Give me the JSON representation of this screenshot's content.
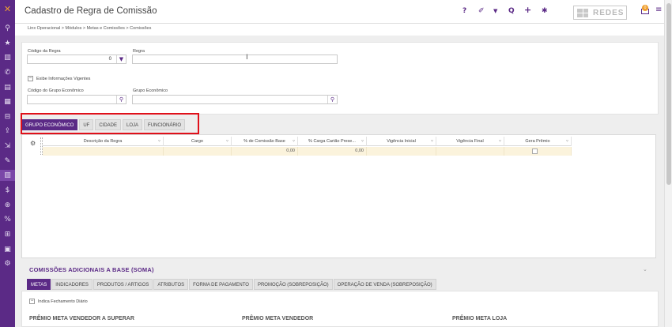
{
  "header": {
    "title": "Cadastro de Regra de Comissão",
    "brand": "REDES",
    "notification_count": "0",
    "icons": [
      "help-icon",
      "eraser-icon",
      "filter-icon",
      "search-icon",
      "add-icon",
      "settings-icon"
    ],
    "help_glyph": "?",
    "eraser_glyph": "✐",
    "filter_glyph": "▼",
    "search_glyph": "Q",
    "add_glyph": "+",
    "settings_glyph": "✱",
    "menu_glyph": "≡"
  },
  "breadcrumb": "Linx Operacional > Módulos > Metas e Comissões > Comissões",
  "sidebar": {
    "items": [
      {
        "icon": "linx-logo-icon",
        "glyph": "✕"
      },
      {
        "icon": "search-icon",
        "glyph": "⚲"
      },
      {
        "icon": "star-icon",
        "glyph": "★"
      },
      {
        "icon": "chart-icon",
        "glyph": "▥"
      },
      {
        "icon": "phone-icon",
        "glyph": "✆"
      },
      {
        "icon": "card-icon",
        "glyph": "▤"
      },
      {
        "icon": "calc-icon",
        "glyph": "▦"
      },
      {
        "icon": "basket-icon",
        "glyph": "⊟"
      },
      {
        "icon": "upload-icon",
        "glyph": "⇪"
      },
      {
        "icon": "truck-icon",
        "glyph": "⇲"
      },
      {
        "icon": "tag-icon",
        "glyph": "✎"
      },
      {
        "icon": "report-icon",
        "glyph": "▥"
      },
      {
        "icon": "dollar-icon",
        "glyph": "$"
      },
      {
        "icon": "coins-icon",
        "glyph": "⊛"
      },
      {
        "icon": "percent-icon",
        "glyph": "%"
      },
      {
        "icon": "cart-icon",
        "glyph": "⊞"
      },
      {
        "icon": "monitor-icon",
        "glyph": "▣"
      },
      {
        "icon": "gears-icon",
        "glyph": "⚙"
      }
    ]
  },
  "filters": {
    "codigo_regra_label": "Código da Regra",
    "codigo_regra_value": "0",
    "regra_label": "Regra",
    "regra_value": "",
    "exibe_vigentes_label": "Exibe Informações Vigentes",
    "codigo_grupo_label": "Código do Grupo Econômico",
    "codigo_grupo_value": "",
    "grupo_label": "Grupo Econômico",
    "grupo_value": ""
  },
  "tabs": [
    "GRUPO ECONÔMICO",
    "UF",
    "CIDADE",
    "LOJA",
    "FUNCIONÁRIO"
  ],
  "grid": {
    "columns": [
      "Descrição da Regra",
      "Cargo",
      "% de Comissão Base",
      "% Carga Cartão Prese...",
      "Vigência Inicial",
      "Vigência Final",
      "Gera Prêmio"
    ],
    "row": [
      "",
      "",
      "0,00",
      "0,00",
      "",
      "",
      ""
    ]
  },
  "section": {
    "title": "COMISSÕES ADICIONAIS A BASE (SOMA)",
    "tabs": [
      "METAS",
      "INDICADORES",
      "PRODUTOS / ARTIGOS",
      "ATRIBUTOS",
      "FORMA DE PAGAMENTO",
      "PROMOÇÃO (SOBREPOSIÇÃO)",
      "OPERAÇÃO DE VENDA (SOBREPOSIÇÃO)"
    ],
    "indica_fechamento_label": "Indica Fechamento Diário",
    "premio_labels": [
      "PRÊMIO META VENDEDOR A SUPERAR",
      "PRÊMIO META VENDEDOR",
      "PRÊMIO META LOJA"
    ]
  },
  "colors": {
    "accent": "#5b2a86",
    "highlight": "#e0101a",
    "row": "#fbf3dc"
  }
}
